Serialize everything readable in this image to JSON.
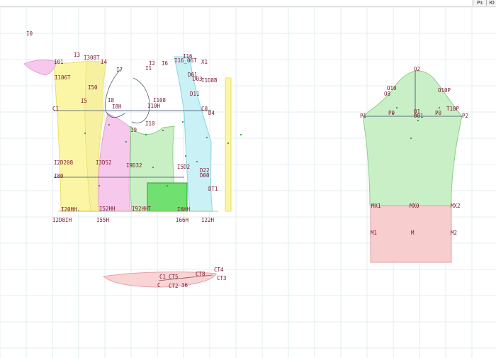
{
  "toolbar": {
    "button_1": "Pз",
    "button_2": "Ю"
  },
  "colors": {
    "grid": "#dbe9ee",
    "front_yellow": "#fbf6a6",
    "pink": "#f6c8ec",
    "green": "#c9f0c4",
    "cyan": "#c9f1f6",
    "sleeve_green": "#c9efc6",
    "sleeve_red": "#f8cdcd",
    "collar": "#f8d4d4",
    "label": "#7a1630"
  },
  "labels": {
    "i0": "I0",
    "i3": "I3",
    "i308t": "I308T",
    "i4": "I4",
    "i7": "I7",
    "i01": "I01",
    "i106t": "I106T",
    "i50": "I50",
    "i5": "I5",
    "c1": "C1",
    "i8": "I8",
    "i8h": "I8H",
    "i2": "I2",
    "i6": "I6",
    "i1": "I1",
    "i16": "I16",
    "i16_06t": "I16_06T",
    "x1": "X1",
    "i108": "I108",
    "i10h": "I10H",
    "i9": "I9",
    "d01": "D01",
    "d03": "D03",
    "i1d8b": "I1D8B",
    "d11": "D11",
    "c0": "C0",
    "d4": "D4",
    "i10": "I10",
    "i2d208": "I2D208",
    "i3d52": "I3D52",
    "i9d32": "I9D32",
    "i5d2": "I5D2",
    "i80": "I80",
    "d22": "D22",
    "d00": "D00",
    "dt1": "DT1",
    "i20hh": "I20HH.",
    "i52hh": "I52HH",
    "i92hh": "I92HHT",
    "i6h": "I6HH",
    "i2d8ih": "I2D8IH",
    "i55h": "I55H",
    "i66h": "I66H",
    "i22h": "I22H",
    "o2": "O2",
    "o10": "O10",
    "o8": "O8",
    "o10p": "O10P",
    "t10p": "T10P",
    "p1": "P1",
    "p0_left": "P0",
    "o1": "O1",
    "o01": "O01",
    "p0_right": "P0",
    "p2": "P2",
    "mx1": "MX1",
    "mx0": "MX0",
    "mx2": "MX2",
    "m1": "M1",
    "m": "M",
    "m2": "M2",
    "ct4": "CT4",
    "c1_collar": "C1",
    "ct5": "CT5",
    "ct8": "CT8",
    "ct3": "CT3",
    "c": "C",
    "ct2": "CT2",
    "c36": "36"
  }
}
